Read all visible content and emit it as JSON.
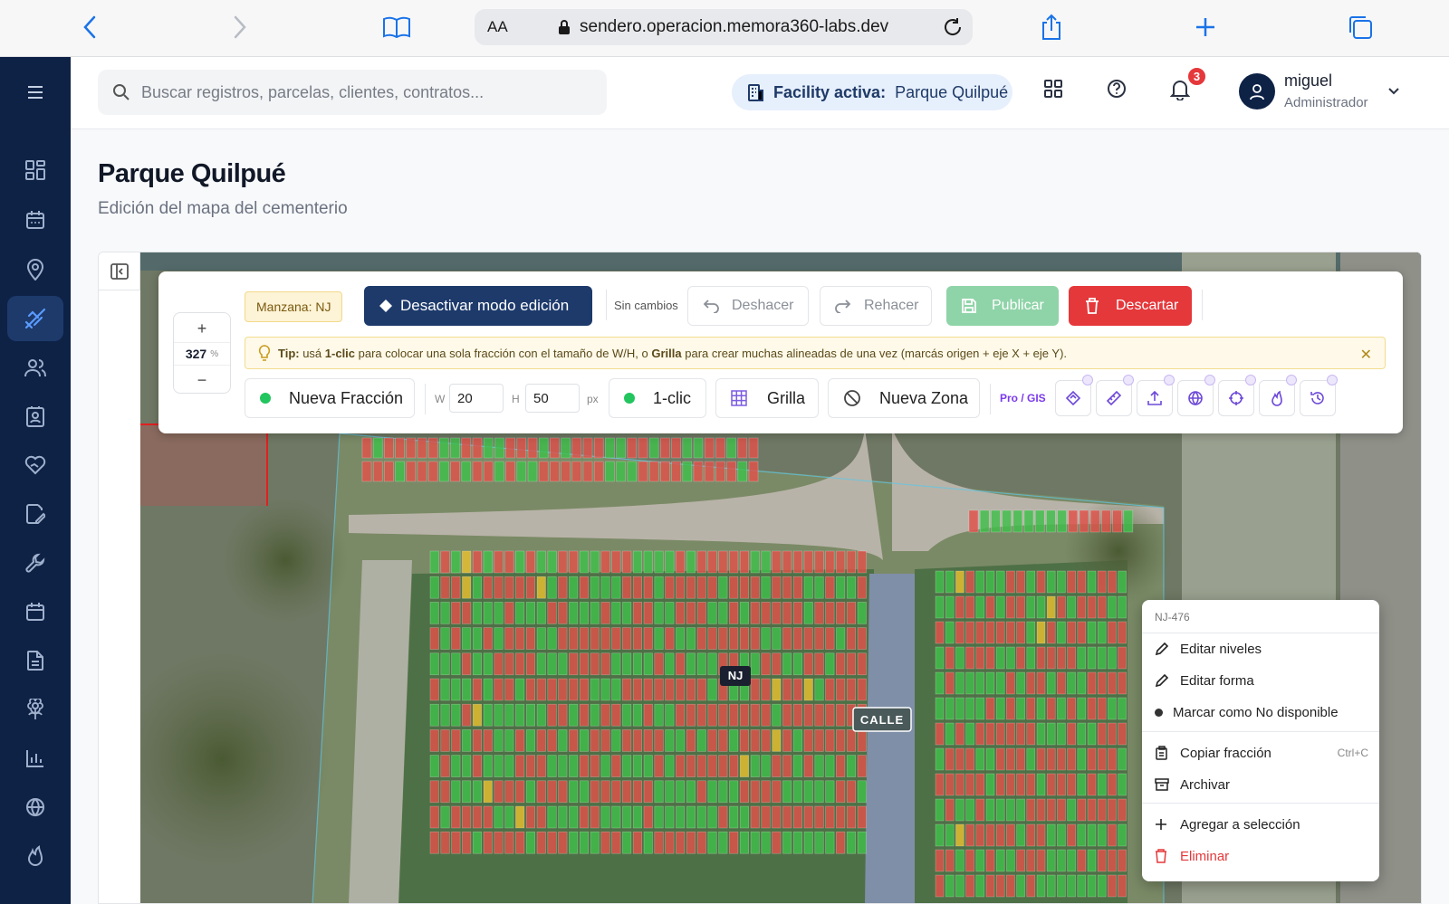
{
  "browser": {
    "aa": "AA",
    "url": "sendero.operacion.memora360-labs.dev"
  },
  "topbar": {
    "search_placeholder": "Buscar registros, parcelas, clientes, contratos...",
    "facility_label": "Facility activa:",
    "facility_name": "Parque Quilpué",
    "notifications": "3",
    "user_name": "miguel",
    "user_role": "Administrador"
  },
  "page": {
    "title": "Parque Quilpué",
    "subtitle": "Edición del mapa del cementerio"
  },
  "toolbar": {
    "zoom_value": "327",
    "zoom_unit": "%",
    "block_chip": "Manzana: NJ",
    "deactivate_edit": "Desactivar modo edición",
    "status": "Sin cambios",
    "undo": "Deshacer",
    "redo": "Rehacer",
    "publish": "Publicar",
    "discard": "Descartar",
    "tip_prefix": "Tip:",
    "tip_text_1": " usá ",
    "tip_one_click": "1-clic",
    "tip_text_2": " para colocar una sola fracción con el tamaño de W/H, o ",
    "tip_grid": "Grilla",
    "tip_text_3": " para crear muchas alineadas de una vez (marcás origen + eje X + eje Y).",
    "new_fraction": "Nueva Fracción",
    "w_label": "W",
    "w_value": "20",
    "h_label": "H",
    "h_value": "50",
    "px_label": "px",
    "one_click": "1-clic",
    "grid": "Grilla",
    "new_zone": "Nueva Zona",
    "pro_gis": "Pro / GIS"
  },
  "map": {
    "block_label": "NJ",
    "street_label": "CALLE"
  },
  "context_menu": {
    "header": "NJ-476",
    "edit_levels": "Editar niveles",
    "edit_shape": "Editar forma",
    "mark_unavailable": "Marcar como No disponible",
    "copy_fraction": "Copiar fracción",
    "copy_shortcut": "Ctrl+C",
    "archive": "Archivar",
    "add_selection": "Agregar a selección",
    "delete": "Eliminar"
  },
  "colors": {
    "sidebar": "#0e2246",
    "primary": "#1d3a6b",
    "occupied": "#e0524a",
    "available": "#3fbf4a",
    "reserved": "#e8c030",
    "publish": "#8fd4a8",
    "discard": "#e5383b"
  }
}
